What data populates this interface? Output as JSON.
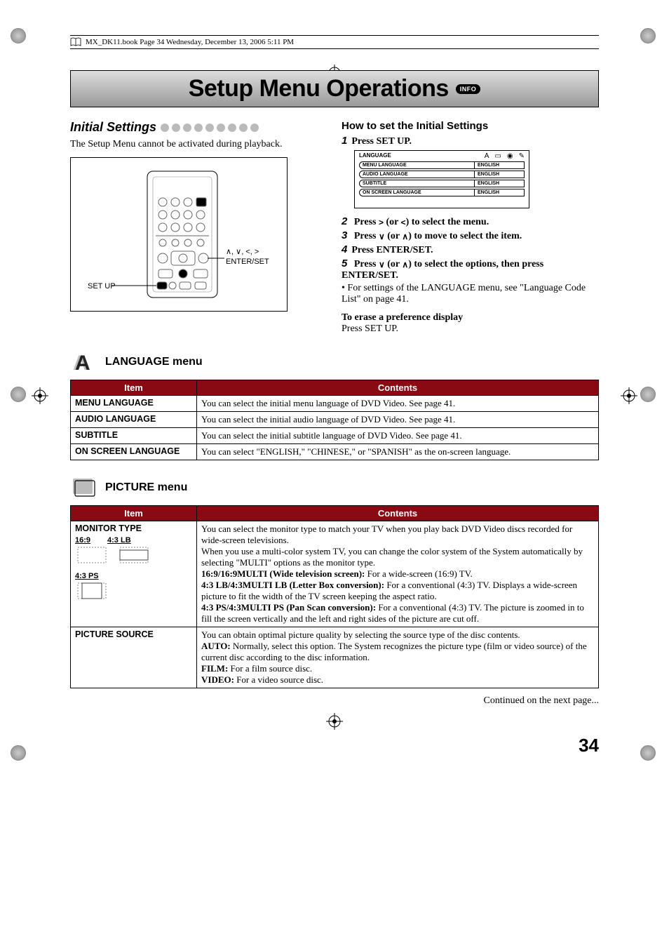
{
  "header": {
    "runhead": "MX_DK11.book  Page 34  Wednesday, December 13, 2006  5:11 PM"
  },
  "title": "Setup Menu Operations",
  "info_badge": "INFO",
  "initial_settings": {
    "heading": "Initial Settings",
    "note": "The Setup Menu cannot be activated during playback.",
    "remote_labels": {
      "left": "SET UP",
      "right": "ENTER/SET",
      "right_top": "∧, ∨, <, >"
    }
  },
  "how_to": {
    "heading": "How to set the Initial Settings",
    "steps": {
      "s1": "Press SET UP.",
      "s2_a": "Press ",
      "s2_b": " (or ",
      "s2_c": ") to select the menu.",
      "s3_a": "Press ",
      "s3_b": " (or ",
      "s3_c": ") to move to select the item.",
      "s4": "Press ENTER/SET.",
      "s5_a": "Press ",
      "s5_b": " (or ",
      "s5_c": ")   to select the options, then press ENTER/SET."
    },
    "note": "For settings of the LANGUAGE menu, see \"Language Code List\" on page 41.",
    "erase_heading": "To erase a preference display",
    "erase_body": "Press SET UP."
  },
  "lang_screenshot": {
    "tab": "LANGUAGE",
    "rows": [
      {
        "item": "MENU LANGUAGE",
        "val": "ENGLISH"
      },
      {
        "item": "AUDIO LANGUAGE",
        "val": "ENGLISH"
      },
      {
        "item": "SUBTITLE",
        "val": "ENGLISH"
      },
      {
        "item": "ON SCREEN LANGUAGE",
        "val": "ENGLISH"
      }
    ]
  },
  "language_menu": {
    "heading": "LANGUAGE menu",
    "columns": {
      "item": "Item",
      "contents": "Contents"
    },
    "rows": [
      {
        "item": "MENU LANGUAGE",
        "contents": "You can select the initial menu language of DVD Video. See page 41."
      },
      {
        "item": "AUDIO LANGUAGE",
        "contents": "You can select the initial audio language of DVD Video. See page 41."
      },
      {
        "item": "SUBTITLE",
        "contents": "You can select the initial subtitle language of DVD Video. See page 41."
      },
      {
        "item": "ON SCREEN LANGUAGE",
        "contents": "You can select \"ENGLISH,\" \"CHINESE,\" or \"SPANISH\" as the on-screen language."
      }
    ]
  },
  "picture_menu": {
    "heading": "PICTURE menu",
    "columns": {
      "item": "Item",
      "contents": "Contents"
    },
    "row1_item": "MONITOR TYPE",
    "row1_icons": {
      "a": "16:9",
      "b": "4:3 LB",
      "c": "4:3 PS"
    },
    "row1_contents": {
      "p1": "You can select the monitor type to match your TV when you play back DVD Video discs recorded for wide-screen televisions.",
      "p2": "When you use a multi-color system TV, you can change the color system of the System automatically by selecting \"MULTI\" options as the monitor type.",
      "p3_b": "16:9/16:9MULTI (Wide television screen):",
      "p3_r": " For a wide-screen (16:9) TV.",
      "p4_b": "4:3 LB/4:3MULTI LB (Letter Box conversion):",
      "p4_r": " For a conventional (4:3) TV. Displays a wide-screen picture to fit the width of the TV screen keeping the aspect ratio.",
      "p5_b": "4:3 PS/4:3MULTI PS (Pan Scan conversion):",
      "p5_r": " For a conventional (4:3) TV. The picture is zoomed in to fill the screen vertically and the left and right sides of the picture are cut off."
    },
    "row2_item": "PICTURE SOURCE",
    "row2_contents": {
      "p1": "You can obtain optimal picture quality by selecting the source type of the disc contents.",
      "p2_b": "AUTO:",
      "p2_r": " Normally, select this option. The System recognizes the picture type (film or video source) of the current disc according to the disc information.",
      "p3_b": "FILM:",
      "p3_r": " For a film source disc.",
      "p4_b": "VIDEO:",
      "p4_r": " For a video source disc."
    }
  },
  "continued": "Continued on the next page...",
  "page_number": "34"
}
